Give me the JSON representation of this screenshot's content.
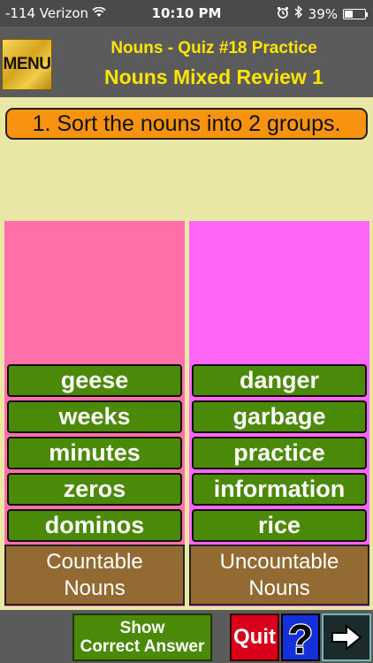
{
  "status_bar": {
    "carrier": "-114 Verizon",
    "time": "10:10 PM",
    "battery": "39%",
    "battery_level": 0.39
  },
  "header": {
    "menu_label": "MENU",
    "title": "Nouns - Quiz #18 Practice",
    "subtitle": "Nouns Mixed Review 1"
  },
  "prompt": "1. Sort the nouns into 2 groups.",
  "columns": [
    {
      "words": [
        "geese",
        "weeks",
        "minutes",
        "zeros",
        "dominos"
      ],
      "label_line1": "Countable",
      "label_line2": "Nouns",
      "color": "#ff6fa8"
    },
    {
      "words": [
        "danger",
        "garbage",
        "practice",
        "information",
        "rice"
      ],
      "label_line1": "Uncountable",
      "label_line2": "Nouns",
      "color": "#ff66f5"
    }
  ],
  "bottom": {
    "show_line1": "Show",
    "show_line2": "Correct Answer",
    "quit": "Quit",
    "help": "?"
  }
}
